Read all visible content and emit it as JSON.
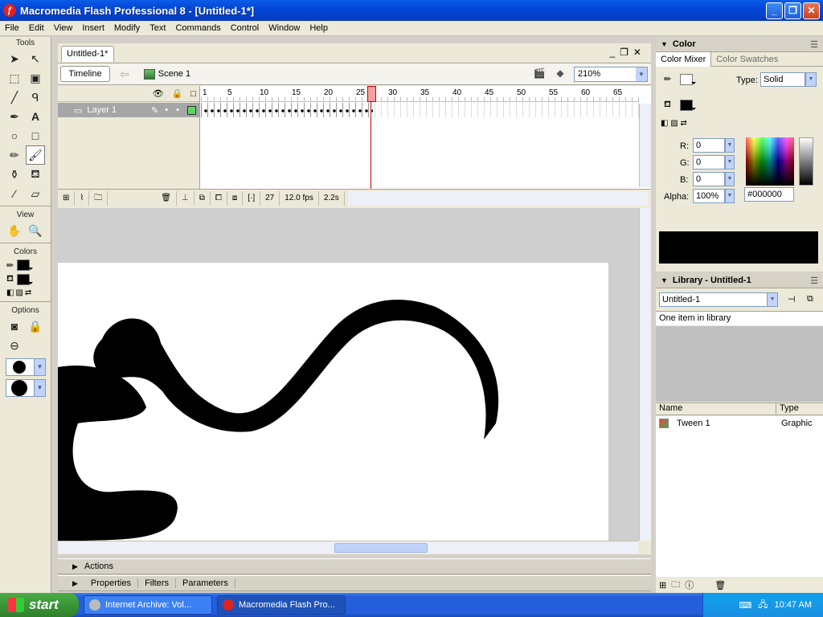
{
  "window": {
    "title": "Macromedia Flash Professional 8 - [Untitled-1*]",
    "app_icon": "flash-icon",
    "controls": [
      "_",
      "❐",
      "✕"
    ]
  },
  "menu": [
    "File",
    "Edit",
    "View",
    "Insert",
    "Modify",
    "Text",
    "Commands",
    "Control",
    "Window",
    "Help"
  ],
  "tools": {
    "header": "Tools",
    "view_header": "View",
    "colors_header": "Colors",
    "options_header": "Options",
    "icons": [
      "arrow",
      "subselect",
      "free-transform",
      "fill-transform",
      "line",
      "lasso",
      "pen",
      "text",
      "oval",
      "rectangle",
      "pencil",
      "brush",
      "ink-bottle",
      "paint-bucket",
      "eyedropper",
      "eraser"
    ],
    "selected": "brush"
  },
  "document": {
    "tab_label": "Untitled-1*",
    "timeline_button": "Timeline",
    "scene_label": "Scene 1",
    "zoom": "210%",
    "colors": {
      "stage_bg": "#ffffff",
      "work_area": "#cfcfcf",
      "stroke": "#000000"
    }
  },
  "timeline": {
    "layer_name": "Layer 1",
    "ruler_labels": [
      "1",
      "5",
      "10",
      "15",
      "20",
      "25",
      "30",
      "35",
      "40",
      "45",
      "50",
      "55",
      "60",
      "65"
    ],
    "current_frame": "27",
    "fps": "12.0 fps",
    "time": "2.2s"
  },
  "bottom_panels": {
    "actions": "Actions",
    "tabs": [
      "Properties",
      "Filters",
      "Parameters"
    ]
  },
  "color_panel": {
    "title": "Color",
    "tab_mixer": "Color Mixer",
    "tab_swatches": "Color Swatches",
    "type_label": "Type:",
    "type_value": "Solid",
    "r_label": "R:",
    "r": "0",
    "g_label": "G:",
    "g": "0",
    "b_label": "B:",
    "b": "0",
    "alpha_label": "Alpha:",
    "alpha": "100%",
    "hex": "#000000"
  },
  "library_panel": {
    "title": "Library - Untitled-1",
    "doc_select": "Untitled-1",
    "status": "One item in library",
    "col_name": "Name",
    "col_type": "Type",
    "item_name": "Tween 1",
    "item_type": "Graphic"
  },
  "taskbar": {
    "start": "start",
    "items": [
      "Internet Archive: Vol...",
      "Macromedia Flash Pro..."
    ],
    "active_index": 1,
    "clock": "10:47 AM"
  }
}
